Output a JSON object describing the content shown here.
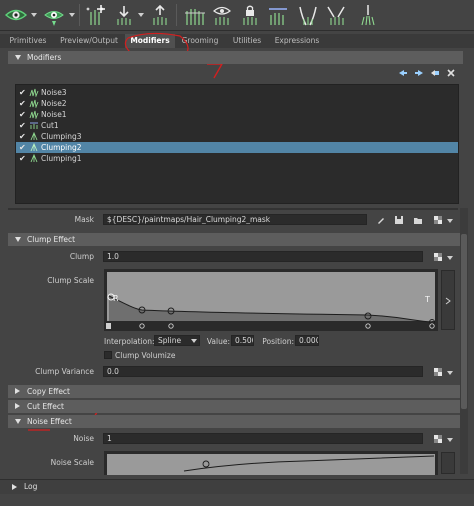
{
  "tabs": [
    {
      "label": "Primitives"
    },
    {
      "label": "Preview/Output"
    },
    {
      "label": "Modifiers"
    },
    {
      "label": "Grooming"
    },
    {
      "label": "Utilities"
    },
    {
      "label": "Expressions"
    }
  ],
  "active_tab": "Modifiers",
  "modifiers_panel": {
    "title": "Modifiers",
    "list": [
      {
        "label": "Noise3",
        "checked": true,
        "selected": false
      },
      {
        "label": "Noise2",
        "checked": true,
        "selected": false
      },
      {
        "label": "Noise1",
        "checked": true,
        "selected": false
      },
      {
        "label": "Cut1",
        "checked": true,
        "selected": false
      },
      {
        "label": "Clumping3",
        "checked": true,
        "selected": false
      },
      {
        "label": "Clumping2",
        "checked": true,
        "selected": true
      },
      {
        "label": "Clumping1",
        "checked": true,
        "selected": false
      }
    ]
  },
  "mask": {
    "label": "Mask",
    "value": "${DESC}/paintmaps/Hair_Clumping2_mask"
  },
  "clump_effect": {
    "title": "Clump Effect",
    "clump_label": "Clump",
    "clump_value": "1.0",
    "clump_scale_label": "Clump Scale",
    "graph_marker_left": "R",
    "graph_marker_right": "T",
    "interpolation_label": "Interpolation:",
    "interpolation_value": "Spline",
    "value_label": "Value:",
    "value_value": "0.500",
    "position_label": "Position:",
    "position_value": "0.000",
    "clump_volumize_label": "Clump Volumize",
    "clump_volumize_checked": false,
    "clump_variance_label": "Clump Variance",
    "clump_variance_value": "0.0"
  },
  "collapsed_sections": [
    {
      "label": "Copy Effect"
    },
    {
      "label": "Cut Effect"
    }
  ],
  "noise_effect": {
    "title": "Noise Effect",
    "noise_label": "Noise",
    "noise_value": "1",
    "noise_scale_label": "Noise Scale"
  },
  "log": {
    "label": "Log"
  },
  "colors": {
    "background": "#444444",
    "selection": "#5285a6",
    "toolbar_icon_green": "#4fbf6a",
    "annotation_red": "#d21f1f"
  },
  "icons": [
    "eye-icon",
    "hair-icon",
    "add-modifier-icon",
    "collapse-icon",
    "lock-icon",
    "comb-icon",
    "save-icon",
    "folder-icon",
    "checker-icon"
  ]
}
